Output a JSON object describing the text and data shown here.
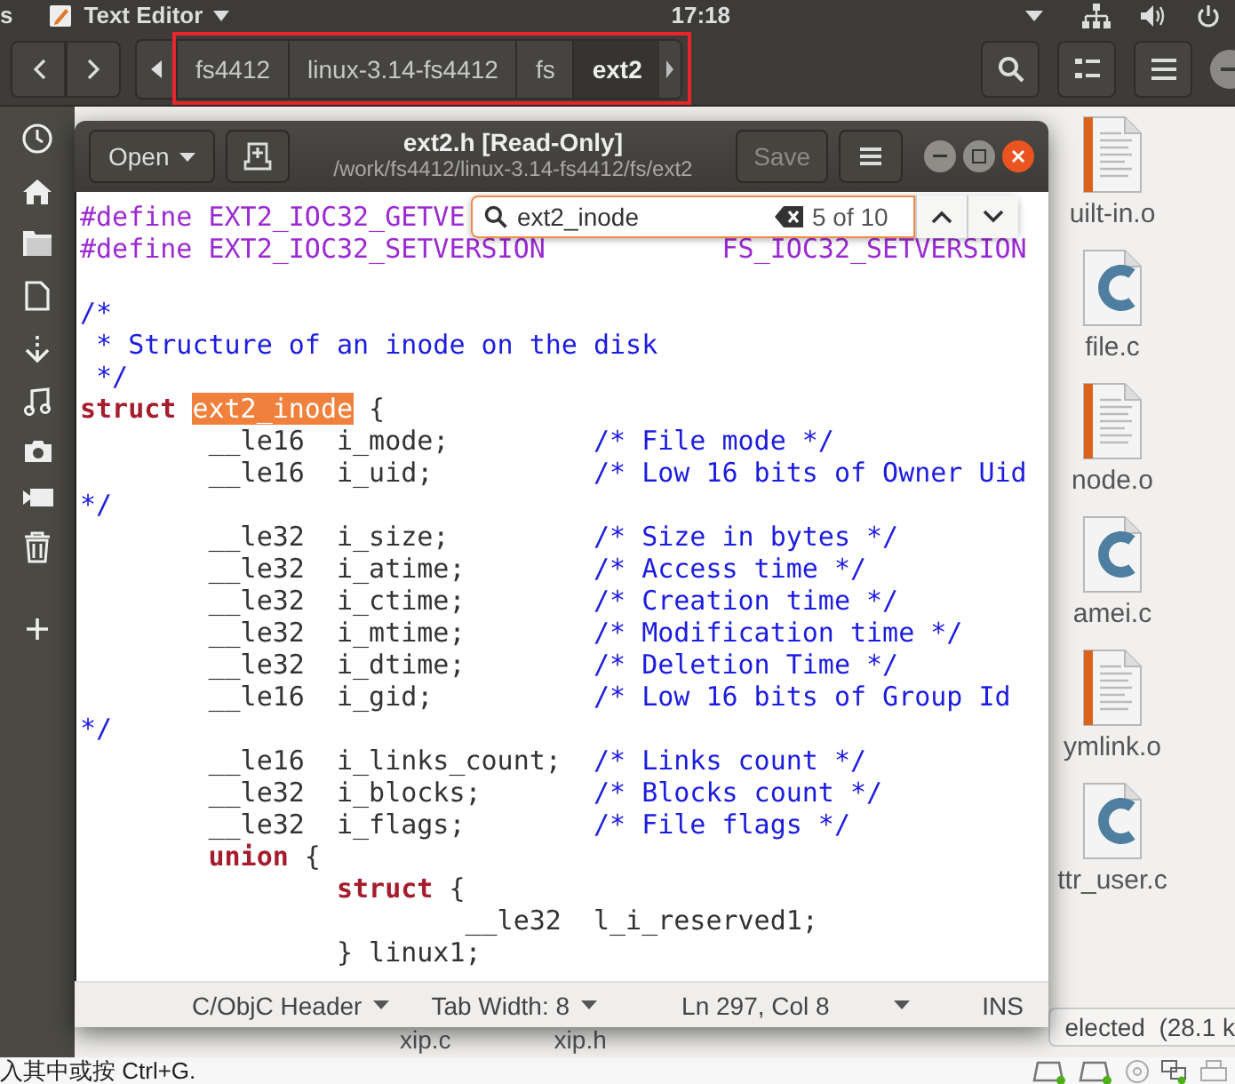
{
  "top_bar": {
    "left_fragment": "s",
    "app_name": "Text Editor",
    "clock": "17:18"
  },
  "file_manager": {
    "path": [
      {
        "label": "fs4412",
        "selected": false
      },
      {
        "label": "linux-3.14-fs4412",
        "selected": false
      },
      {
        "label": "fs",
        "selected": false
      },
      {
        "label": "ext2",
        "selected": true
      }
    ],
    "files": [
      {
        "name": "uilt-in.o",
        "kind": "object"
      },
      {
        "name": "file.c",
        "kind": "c"
      },
      {
        "name": "node.o",
        "kind": "object"
      },
      {
        "name": "amei.c",
        "kind": "c"
      },
      {
        "name": "ymlink.o",
        "kind": "object"
      },
      {
        "name": "ttr_user.c",
        "kind": "c"
      }
    ],
    "bottom_files": [
      "xip.c",
      "xip.h"
    ],
    "status": "elected  (28.1 k"
  },
  "editor": {
    "title": "ext2.h [Read-Only]",
    "subtitle": "/work/fs4412/linux-3.14-fs4412/fs/ext2",
    "open_button": "Open",
    "save_button": {
      "label": "Save",
      "disabled": true
    },
    "search": {
      "value": "ext2_inode",
      "count": "5 of 10"
    },
    "lines": [
      {
        "kind": "code",
        "tokens": [
          {
            "kind": "preproc",
            "text": "#define EXT2_IOC32_GETVE"
          }
        ]
      },
      {
        "kind": "code",
        "tokens": [
          {
            "kind": "preproc",
            "text": "#define EXT2_IOC32_SETVERSION           FS_IOC32_SETVERSION"
          }
        ]
      },
      {
        "kind": "blank"
      },
      {
        "kind": "code",
        "tokens": [
          {
            "kind": "comment",
            "text": "/*"
          }
        ]
      },
      {
        "kind": "code",
        "tokens": [
          {
            "kind": "comment",
            "text": " * Structure of an inode on the disk"
          }
        ]
      },
      {
        "kind": "code",
        "tokens": [
          {
            "kind": "comment",
            "text": " */"
          }
        ]
      },
      {
        "kind": "code",
        "tokens": [
          {
            "kind": "keyword",
            "text": "struct "
          },
          {
            "kind": "match",
            "text": "ext2_inode"
          },
          {
            "kind": "plain",
            "text": " {"
          }
        ]
      },
      {
        "kind": "code",
        "tokens": [
          {
            "kind": "plain",
            "text": "        __le16  i_mode;         "
          },
          {
            "kind": "comment",
            "text": "/* File mode */"
          }
        ]
      },
      {
        "kind": "code",
        "tokens": [
          {
            "kind": "plain",
            "text": "        __le16  i_uid;          "
          },
          {
            "kind": "comment",
            "text": "/* Low 16 bits of Owner Uid"
          }
        ]
      },
      {
        "kind": "code",
        "tokens": [
          {
            "kind": "comment",
            "text": "*/"
          }
        ]
      },
      {
        "kind": "code",
        "tokens": [
          {
            "kind": "plain",
            "text": "        __le32  i_size;         "
          },
          {
            "kind": "comment",
            "text": "/* Size in bytes */"
          }
        ]
      },
      {
        "kind": "code",
        "tokens": [
          {
            "kind": "plain",
            "text": "        __le32  i_atime;        "
          },
          {
            "kind": "comment",
            "text": "/* Access time */"
          }
        ]
      },
      {
        "kind": "code",
        "tokens": [
          {
            "kind": "plain",
            "text": "        __le32  i_ctime;        "
          },
          {
            "kind": "comment",
            "text": "/* Creation time */"
          }
        ]
      },
      {
        "kind": "code",
        "tokens": [
          {
            "kind": "plain",
            "text": "        __le32  i_mtime;        "
          },
          {
            "kind": "comment",
            "text": "/* Modification time */"
          }
        ]
      },
      {
        "kind": "code",
        "tokens": [
          {
            "kind": "plain",
            "text": "        __le32  i_dtime;        "
          },
          {
            "kind": "comment",
            "text": "/* Deletion Time */"
          }
        ]
      },
      {
        "kind": "code",
        "tokens": [
          {
            "kind": "plain",
            "text": "        __le16  i_gid;          "
          },
          {
            "kind": "comment",
            "text": "/* Low 16 bits of Group Id"
          }
        ]
      },
      {
        "kind": "code",
        "tokens": [
          {
            "kind": "comment",
            "text": "*/"
          }
        ]
      },
      {
        "kind": "code",
        "tokens": [
          {
            "kind": "plain",
            "text": "        __le16  i_links_count;  "
          },
          {
            "kind": "comment",
            "text": "/* Links count */"
          }
        ]
      },
      {
        "kind": "code",
        "tokens": [
          {
            "kind": "plain",
            "text": "        __le32  i_blocks;       "
          },
          {
            "kind": "comment",
            "text": "/* Blocks count */"
          }
        ]
      },
      {
        "kind": "code",
        "tokens": [
          {
            "kind": "plain",
            "text": "        __le32  i_flags;        "
          },
          {
            "kind": "comment",
            "text": "/* File flags */"
          }
        ]
      },
      {
        "kind": "code",
        "tokens": [
          {
            "kind": "keyword",
            "text": "        union"
          },
          {
            "kind": "plain",
            "text": " {"
          }
        ]
      },
      {
        "kind": "code",
        "tokens": [
          {
            "kind": "keyword",
            "text": "                struct"
          },
          {
            "kind": "plain",
            "text": " {"
          }
        ]
      },
      {
        "kind": "code",
        "tokens": [
          {
            "kind": "plain",
            "text": "                        __le32  l_i_reserved1;"
          }
        ]
      },
      {
        "kind": "code",
        "tokens": [
          {
            "kind": "plain",
            "text": "                } linux1;"
          }
        ]
      }
    ],
    "status_bar": {
      "language": "C/ObjC Header",
      "tab_width": "Tab Width: 8",
      "position": "Ln 297, Col 8",
      "mode": "INS"
    }
  },
  "hint_bar": {
    "text": "入其中或按 Ctrl+G."
  }
}
